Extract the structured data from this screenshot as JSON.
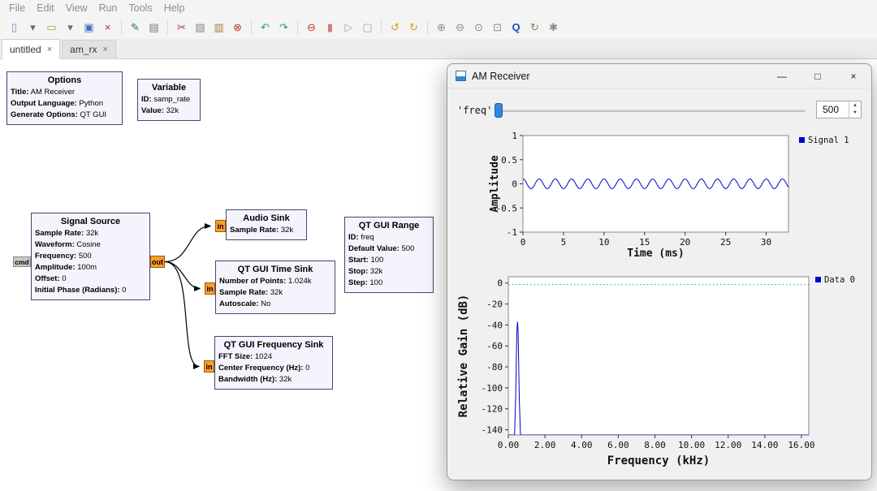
{
  "menu": {
    "items": [
      "File",
      "Edit",
      "View",
      "Run",
      "Tools",
      "Help"
    ]
  },
  "toolbar": {
    "icons": [
      {
        "name": "new-file-icon",
        "glyph": "▯",
        "color": "#6b8cba"
      },
      {
        "name": "new-file-dropdown-icon",
        "glyph": "▾",
        "color": "#666666"
      },
      {
        "name": "open-file-icon",
        "glyph": "▭",
        "color": "#c09a3e"
      },
      {
        "name": "open-file-dropdown-icon",
        "glyph": "▾",
        "color": "#666666"
      },
      {
        "name": "save-icon",
        "glyph": "▣",
        "color": "#3f6fbf"
      },
      {
        "name": "close-tab-icon",
        "glyph": "×",
        "color": "#c03030"
      },
      {
        "name": "sep"
      },
      {
        "name": "screen-capture-icon",
        "glyph": "✎",
        "color": "#2f7d4f"
      },
      {
        "name": "canvas-grid-icon",
        "glyph": "▤",
        "color": "#777777"
      },
      {
        "name": "sep"
      },
      {
        "name": "cut-icon",
        "glyph": "✂",
        "color": "#c03030"
      },
      {
        "name": "copy-icon",
        "glyph": "▧",
        "color": "#8a8a8a"
      },
      {
        "name": "paste-icon",
        "glyph": "▥",
        "color": "#a87840"
      },
      {
        "name": "delete-icon",
        "glyph": "⊗",
        "color": "#c03030"
      },
      {
        "name": "sep"
      },
      {
        "name": "undo-icon",
        "glyph": "↶",
        "color": "#2e9e6b"
      },
      {
        "name": "redo-icon",
        "glyph": "↷",
        "color": "#2e9e6b"
      },
      {
        "name": "sep"
      },
      {
        "name": "errors-icon",
        "glyph": "⊖",
        "color": "#d03030"
      },
      {
        "name": "reload-blocks-icon",
        "glyph": "▮",
        "color": "#cc7a7a"
      },
      {
        "name": "execute-icon",
        "glyph": "▷",
        "color": "#9aa0a6"
      },
      {
        "name": "kill-icon",
        "glyph": "▢",
        "color": "#9aa0a6"
      },
      {
        "name": "sep"
      },
      {
        "name": "connect-bus-icon",
        "glyph": "↺",
        "color": "#d4a017"
      },
      {
        "name": "disconnect-bus-icon",
        "glyph": "↻",
        "color": "#d4a017"
      },
      {
        "name": "sep"
      },
      {
        "name": "zoom-in-icon",
        "glyph": "⊕",
        "color": "#8a8a8a"
      },
      {
        "name": "zoom-out-icon",
        "glyph": "⊖",
        "color": "#8a8a8a"
      },
      {
        "name": "zoom-fit-icon",
        "glyph": "⊙",
        "color": "#8a8a8a"
      },
      {
        "name": "snapshot-icon",
        "glyph": "⊡",
        "color": "#8a8a8a"
      },
      {
        "name": "find-block-icon",
        "glyph": "Q",
        "color": "#1a4fc4"
      },
      {
        "name": "refresh-icon",
        "glyph": "↻",
        "color": "#7a8a55"
      },
      {
        "name": "tools-icon",
        "glyph": "✱",
        "color": "#8a8a8a"
      }
    ]
  },
  "tabs": [
    {
      "label": "untitled",
      "close_icon": "×"
    },
    {
      "label": "am_rx",
      "close_icon": "×"
    }
  ],
  "ports": {
    "cmd": "cmd",
    "out": "out",
    "in": "in"
  },
  "blocks": {
    "options": {
      "title": "Options",
      "params": [
        {
          "key": "Title:",
          "value": "AM Receiver"
        },
        {
          "key": "Output Language:",
          "value": "Python"
        },
        {
          "key": "Generate Options:",
          "value": "QT GUI"
        }
      ]
    },
    "variable": {
      "title": "Variable",
      "params": [
        {
          "key": "ID:",
          "value": "samp_rate"
        },
        {
          "key": "Value:",
          "value": "32k"
        }
      ]
    },
    "signal_source": {
      "title": "Signal Source",
      "params": [
        {
          "key": "Sample Rate:",
          "value": "32k"
        },
        {
          "key": "Waveform:",
          "value": "Cosine"
        },
        {
          "key": "Frequency:",
          "value": "500"
        },
        {
          "key": "Amplitude:",
          "value": "100m"
        },
        {
          "key": "Offset:",
          "value": "0"
        },
        {
          "key": "Initial Phase (Radians):",
          "value": "0"
        }
      ]
    },
    "audio_sink": {
      "title": "Audio Sink",
      "params": [
        {
          "key": "Sample Rate:",
          "value": "32k"
        }
      ]
    },
    "time_sink": {
      "title": "QT GUI Time Sink",
      "params": [
        {
          "key": "Number of Points:",
          "value": "1.024k"
        },
        {
          "key": "Sample Rate:",
          "value": "32k"
        },
        {
          "key": "Autoscale:",
          "value": "No"
        }
      ]
    },
    "freq_sink": {
      "title": "QT GUI Frequency Sink",
      "params": [
        {
          "key": "FFT Size:",
          "value": "1024"
        },
        {
          "key": "Center Frequency (Hz):",
          "value": "0"
        },
        {
          "key": "Bandwidth (Hz):",
          "value": "32k"
        }
      ]
    },
    "range": {
      "title": "QT GUI Range",
      "params": [
        {
          "key": "ID:",
          "value": "freq"
        },
        {
          "key": "Default Value:",
          "value": "500"
        },
        {
          "key": "Start:",
          "value": "100"
        },
        {
          "key": "Stop:",
          "value": "32k"
        },
        {
          "key": "Step:",
          "value": "100"
        }
      ]
    }
  },
  "window": {
    "title": "AM Receiver",
    "controls": {
      "minimize": "—",
      "maximize": "□",
      "close": "×"
    },
    "freq_control": {
      "label": "'freq'",
      "value": 500,
      "min": 100,
      "max": 32000,
      "spin_up": "▲",
      "spin_down": "▼"
    }
  },
  "chart_data": [
    {
      "type": "line",
      "title": "",
      "xlabel": "Time (ms)",
      "ylabel": "Amplitude",
      "xlim": [
        0,
        32.75
      ],
      "ylim": [
        -1,
        1
      ],
      "xtick_vals": [
        0,
        5,
        10,
        15,
        20,
        25,
        30
      ],
      "xtick_labels": [
        "0",
        "5",
        "10",
        "15",
        "20",
        "25",
        "30"
      ],
      "ytick_vals": [
        1,
        0.5,
        0,
        -0.5,
        -1
      ],
      "ytick_labels": [
        "1",
        "0.5",
        "0",
        "-0.5",
        "-1"
      ],
      "grid": false,
      "legend_position": "top-right",
      "legend": [
        {
          "label": "Signal 1",
          "color": "#0000d0"
        }
      ],
      "series": [
        {
          "name": "Signal 1",
          "color": "#0000d0",
          "generator": {
            "kind": "cosine",
            "frequency_hz": 500,
            "amplitude": 0.1,
            "offset": 0,
            "duration_ms": 32.75,
            "samples": 640
          }
        }
      ]
    },
    {
      "type": "line",
      "title": "",
      "xlabel": "Frequency (kHz)",
      "ylabel": "Relative Gain (dB)",
      "xlim": [
        0,
        16.4
      ],
      "ylim": [
        -145,
        6
      ],
      "xtick_vals": [
        0,
        2,
        4,
        6,
        8,
        10,
        12,
        14,
        16
      ],
      "xtick_labels": [
        "0.00",
        "2.00",
        "4.00",
        "6.00",
        "8.00",
        "10.00",
        "12.00",
        "14.00",
        "16.00"
      ],
      "ytick_vals": [
        0,
        -20,
        -40,
        -60,
        -80,
        -100,
        -120,
        -140
      ],
      "ytick_labels": [
        "0",
        "-20",
        "-40",
        "-60",
        "-80",
        "-100",
        "-120",
        "-140"
      ],
      "grid": false,
      "legend_position": "top-right",
      "legend": [
        {
          "label": "Data 0",
          "color": "#0000d0"
        }
      ],
      "reference_line": {
        "y": -1.5,
        "color": "#00b0b0",
        "style": "dotted"
      },
      "series": [
        {
          "name": "Data 0",
          "color": "#0000d0",
          "points": [
            [
              0,
              -145
            ],
            [
              0.34,
              -145
            ],
            [
              0.4,
              -110
            ],
            [
              0.44,
              -70
            ],
            [
              0.47,
              -45
            ],
            [
              0.5,
              -37
            ],
            [
              0.53,
              -45
            ],
            [
              0.56,
              -70
            ],
            [
              0.6,
              -110
            ],
            [
              0.66,
              -145
            ],
            [
              16.4,
              -145
            ]
          ]
        }
      ]
    }
  ]
}
